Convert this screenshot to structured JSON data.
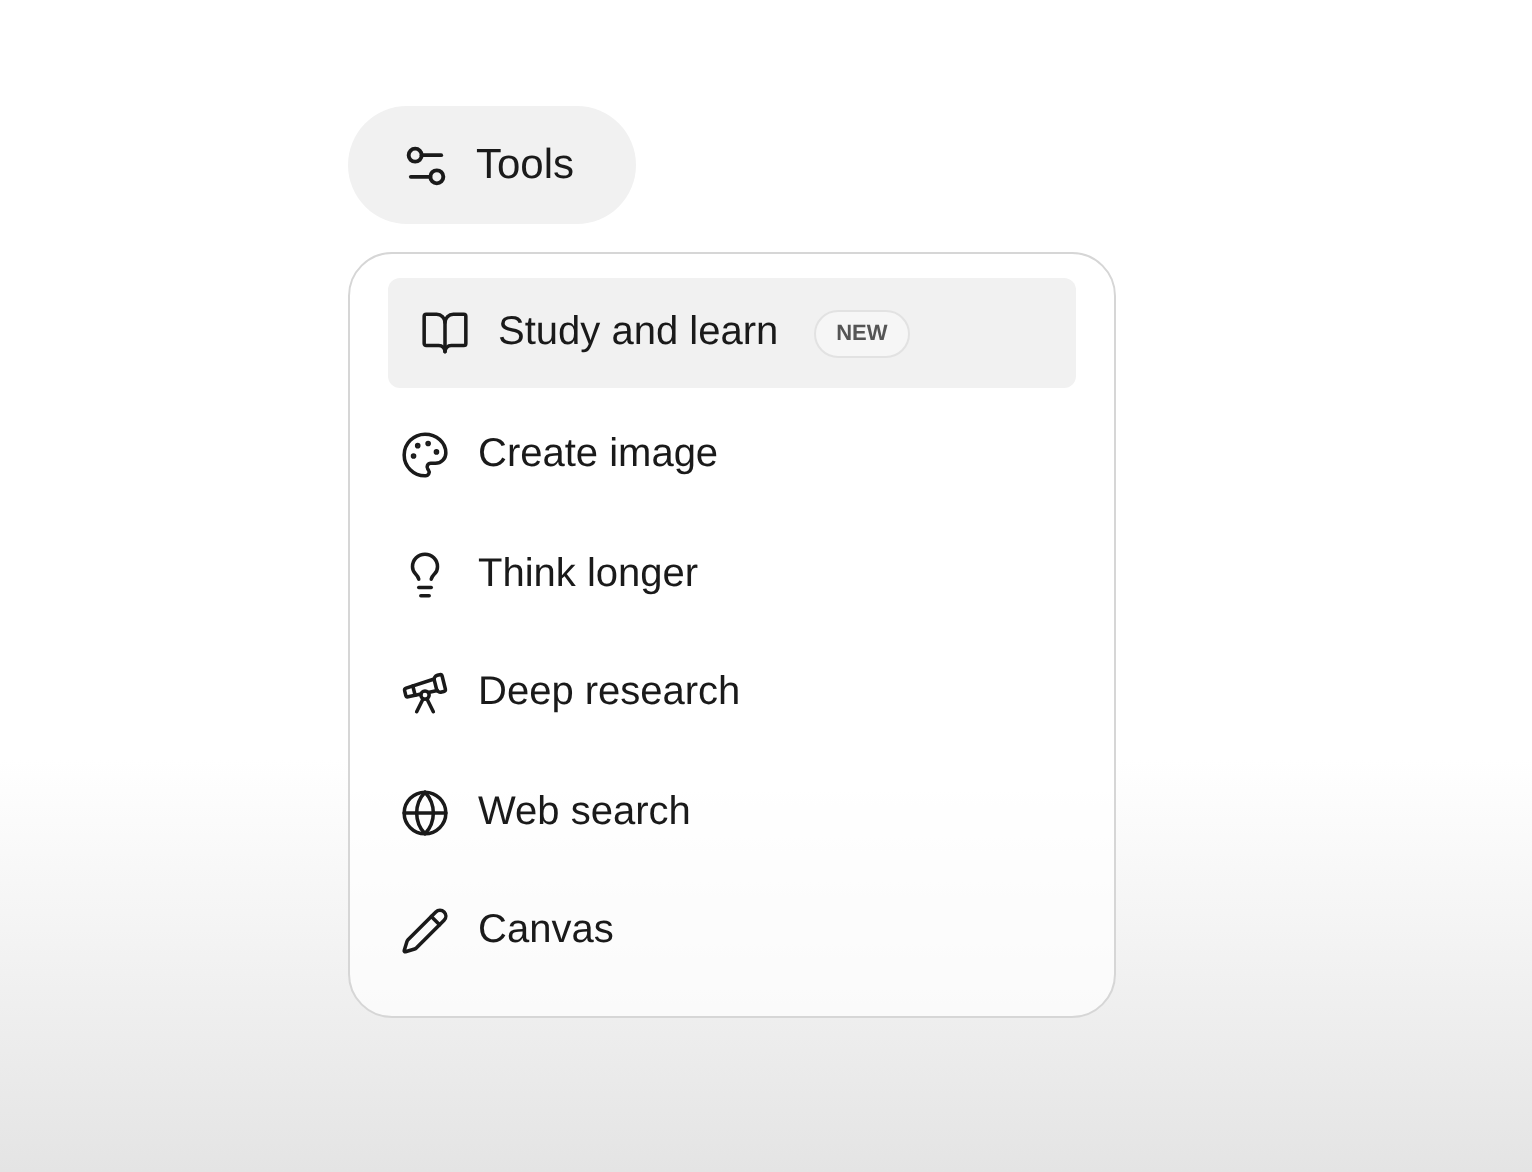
{
  "tools_button": {
    "label": "Tools"
  },
  "menu": {
    "items": [
      {
        "label": "Study and learn",
        "badge": "NEW",
        "selected": true
      },
      {
        "label": "Create image",
        "selected": false
      },
      {
        "label": "Think longer",
        "selected": false
      },
      {
        "label": "Deep research",
        "selected": false
      },
      {
        "label": "Web search",
        "selected": false
      },
      {
        "label": "Canvas",
        "selected": false
      }
    ]
  }
}
